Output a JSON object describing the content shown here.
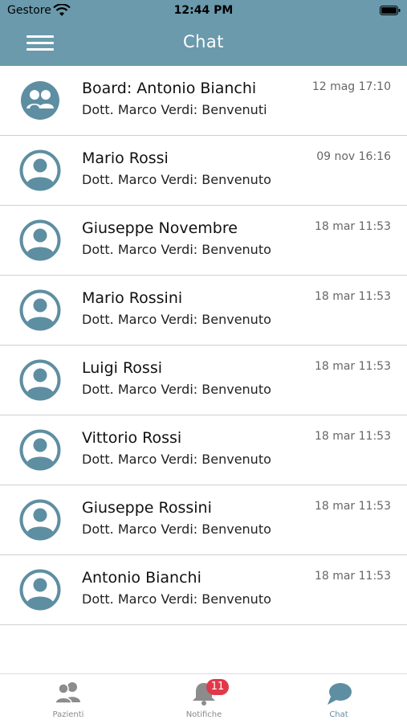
{
  "status_bar": {
    "carrier": "Gestore",
    "time": "12:44 PM"
  },
  "header": {
    "title": "Chat"
  },
  "colors": {
    "primary": "#6a9aac",
    "avatar": "#5e8ea1",
    "badge": "#e0394a"
  },
  "chats": [
    {
      "name": "Board: Antonio Bianchi",
      "message": "Dott. Marco Verdi: Benvenuti",
      "date": "12 mag 17:10",
      "icon": "group-avatar-icon"
    },
    {
      "name": "Mario Rossi",
      "message": "Dott. Marco Verdi: Benvenuto",
      "date": "09 nov 16:16",
      "icon": "user-avatar-icon"
    },
    {
      "name": "Giuseppe Novembre",
      "message": "Dott. Marco Verdi: Benvenuto",
      "date": "18 mar 11:53",
      "icon": "user-avatar-icon"
    },
    {
      "name": "Mario Rossini",
      "message": "Dott. Marco Verdi: Benvenuto",
      "date": "18 mar 11:53",
      "icon": "user-avatar-icon"
    },
    {
      "name": "Luigi Rossi",
      "message": "Dott. Marco Verdi: Benvenuto",
      "date": "18 mar 11:53",
      "icon": "user-avatar-icon"
    },
    {
      "name": "Vittorio Rossi",
      "message": "Dott. Marco Verdi: Benvenuto",
      "date": "18 mar 11:53",
      "icon": "user-avatar-icon"
    },
    {
      "name": "Giuseppe Rossini",
      "message": "Dott. Marco Verdi: Benvenuto",
      "date": "18 mar 11:53",
      "icon": "user-avatar-icon"
    },
    {
      "name": "Antonio Bianchi",
      "message": "Dott. Marco Verdi: Benvenuto",
      "date": "18 mar 11:53",
      "icon": "user-avatar-icon"
    }
  ],
  "tabbar": {
    "tabs": [
      {
        "label": "Pazienti",
        "icon": "patients-icon"
      },
      {
        "label": "Notifiche",
        "icon": "bell-icon",
        "badge": "11"
      },
      {
        "label": "Chat",
        "icon": "chat-icon",
        "active": true
      }
    ]
  }
}
